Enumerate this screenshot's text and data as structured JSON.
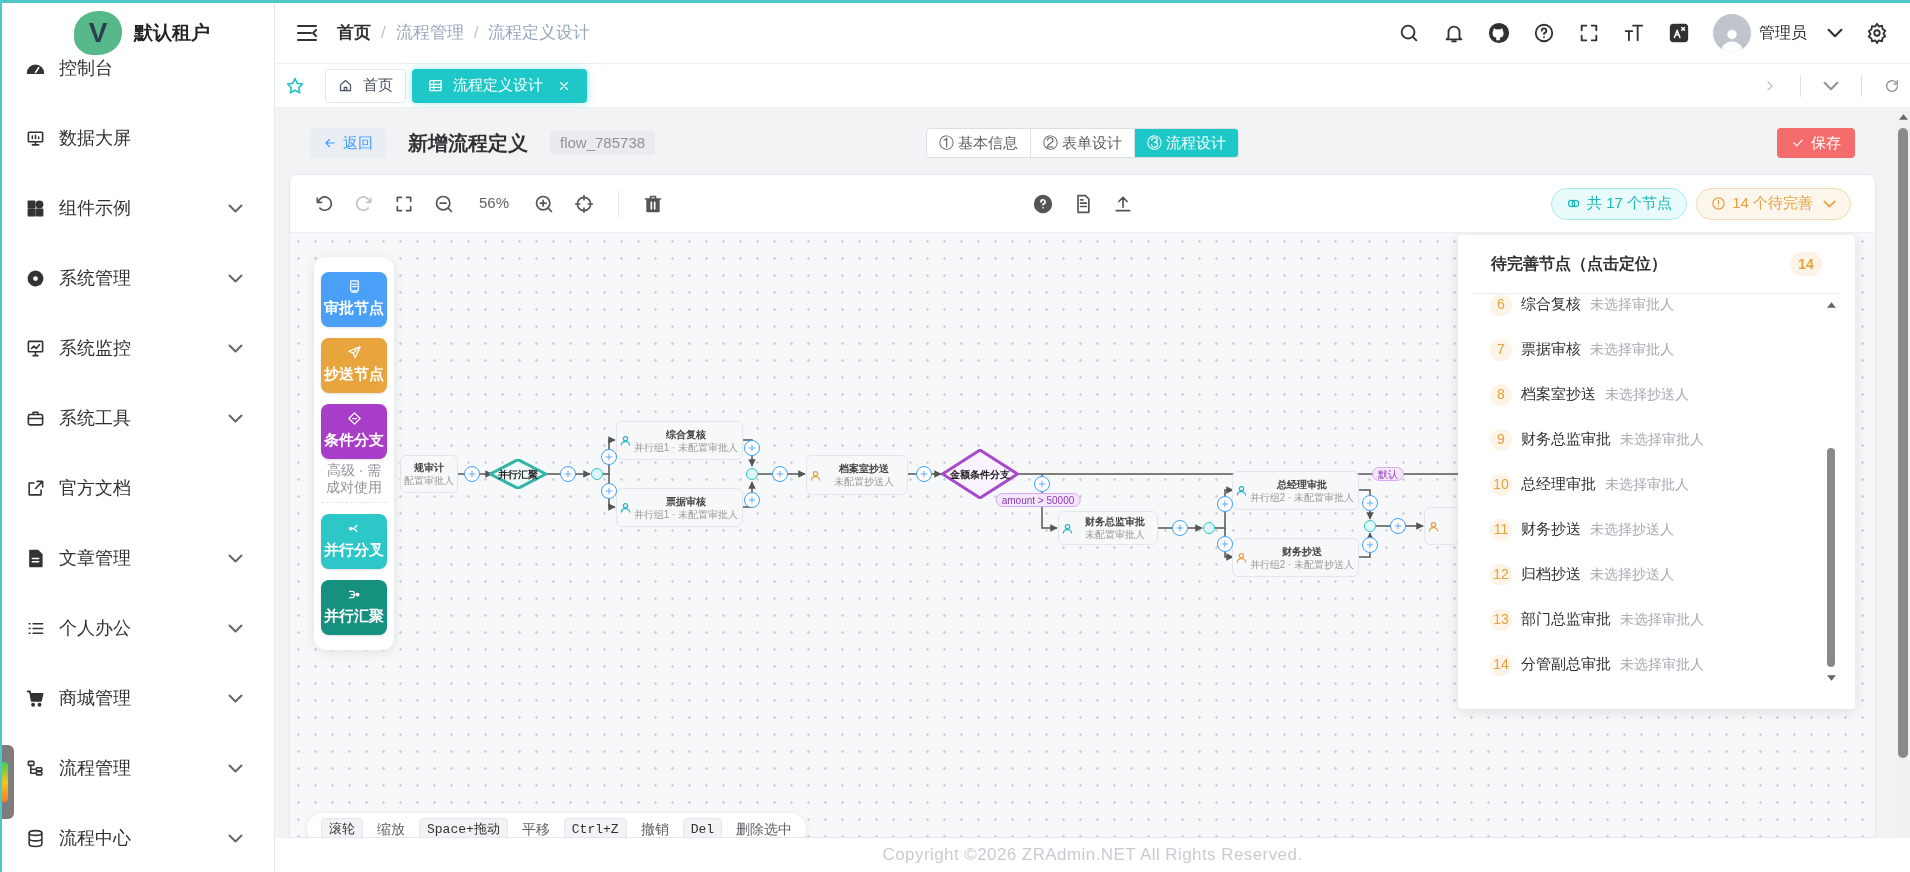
{
  "sidebar": {
    "logo_letter": "V",
    "tenant": "默认租户",
    "items": [
      {
        "label": "控制台",
        "expandable": false
      },
      {
        "label": "数据大屏",
        "expandable": false
      },
      {
        "label": "组件示例",
        "expandable": true
      },
      {
        "label": "系统管理",
        "expandable": true
      },
      {
        "label": "系统监控",
        "expandable": true
      },
      {
        "label": "系统工具",
        "expandable": true
      },
      {
        "label": "官方文档",
        "expandable": false
      },
      {
        "label": "文章管理",
        "expandable": true
      },
      {
        "label": "个人办公",
        "expandable": true
      },
      {
        "label": "商城管理",
        "expandable": true
      },
      {
        "label": "流程管理",
        "expandable": true
      },
      {
        "label": "流程中心",
        "expandable": true
      }
    ]
  },
  "header": {
    "breadcrumb": [
      "首页",
      "流程管理",
      "流程定义设计"
    ],
    "breadcrumb_separator": "/",
    "user": "管理员"
  },
  "tabs": [
    {
      "label": "首页",
      "selected": false
    },
    {
      "label": "流程定义设计",
      "selected": true
    }
  ],
  "page": {
    "back": "返回",
    "title": "新增流程定义",
    "code": "flow_785738",
    "steps": [
      {
        "label": "① 基本信息",
        "selected": false
      },
      {
        "label": "② 表单设计",
        "selected": false
      },
      {
        "label": "③ 流程设计",
        "selected": true
      }
    ],
    "save": "保存"
  },
  "toolbar": {
    "zoom": "56%",
    "node_count": "共 17 个节点",
    "pending": "14 个待完善"
  },
  "palette": [
    {
      "kind": "approver",
      "label": "审批节点",
      "color": "#4a9ff6"
    },
    {
      "kind": "cc",
      "label": "抄送节点",
      "color": "#e8a53d"
    },
    {
      "kind": "condition",
      "label": "条件分支",
      "color": "#a83ec7",
      "note": "高级 · 需成对使用"
    },
    {
      "kind": "fork",
      "label": "并行分叉",
      "color": "#2ec7c7"
    },
    {
      "kind": "join",
      "label": "并行汇聚",
      "color": "#16917f"
    }
  ],
  "diagram": {
    "nodes": [
      {
        "kind": "fragment",
        "title": "规审计",
        "subtitle": "配置审批人"
      },
      {
        "kind": "gateway",
        "title": "并行汇聚"
      },
      {
        "kind": "approver",
        "title": "综合复核",
        "subtitle": "并行组1 · 未配置审批人"
      },
      {
        "kind": "approver",
        "title": "票据审核",
        "subtitle": "并行组1 · 未配置审批人"
      },
      {
        "kind": "cc",
        "title": "档案室抄送",
        "subtitle": "未配置抄送人"
      },
      {
        "kind": "condition",
        "title": "金额条件分支"
      },
      {
        "kind": "approver",
        "title": "财务总监审批",
        "subtitle": "未配置审批人"
      },
      {
        "kind": "approver",
        "title": "总经理审批",
        "subtitle": "并行组2 · 未配置审批人"
      },
      {
        "kind": "cc",
        "title": "财务抄送",
        "subtitle": "并行组2 · 未配置抄送人"
      },
      {
        "kind": "cc"
      }
    ],
    "edge_labels": [
      "amount > 50000",
      "默认"
    ]
  },
  "pending_panel": {
    "title": "待完善节点（点击定位）",
    "count": "14",
    "items": [
      {
        "number": "6",
        "name": "综合复核",
        "hint": "未选择审批人"
      },
      {
        "number": "7",
        "name": "票据审核",
        "hint": "未选择审批人"
      },
      {
        "number": "8",
        "name": "档案室抄送",
        "hint": "未选择抄送人"
      },
      {
        "number": "9",
        "name": "财务总监审批",
        "hint": "未选择审批人"
      },
      {
        "number": "10",
        "name": "总经理审批",
        "hint": "未选择审批人"
      },
      {
        "number": "11",
        "name": "财务抄送",
        "hint": "未选择抄送人"
      },
      {
        "number": "12",
        "name": "归档抄送",
        "hint": "未选择抄送人"
      },
      {
        "number": "13",
        "name": "部门总监审批",
        "hint": "未选择审批人"
      },
      {
        "number": "14",
        "name": "分管副总审批",
        "hint": "未选择审批人"
      }
    ]
  },
  "shortcuts": [
    {
      "key": "滚轮",
      "action": "缩放"
    },
    {
      "key": "Space+拖动",
      "action": "平移"
    },
    {
      "key": "Ctrl+Z",
      "action": "撤销"
    },
    {
      "key": "Del",
      "action": "删除选中"
    }
  ],
  "footer": "Copyright ©2026 ZRAdmin.NET All Rights Reserved."
}
